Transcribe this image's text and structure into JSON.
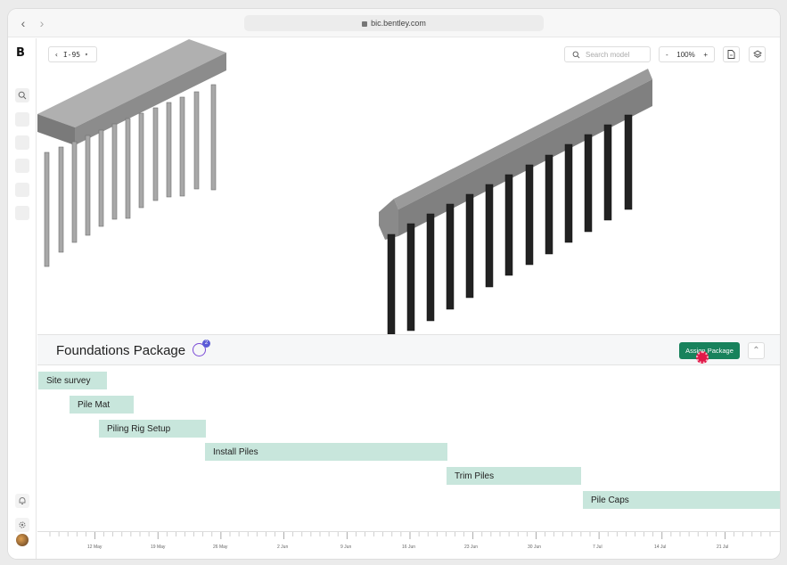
{
  "browser": {
    "url": "bic.bentley.com"
  },
  "rail": {
    "logo": "B"
  },
  "toolbar": {
    "model": "I-95",
    "search_placeholder": "Search model",
    "zoom_minus": "-",
    "zoom_level": "100%",
    "zoom_plus": "+"
  },
  "package": {
    "title": "Foundations Package",
    "badge_count": "2",
    "assign_label": "Assign Package"
  },
  "tasks": [
    {
      "name": "Site survey"
    },
    {
      "name": "Pile Mat"
    },
    {
      "name": "Piling Rig Setup"
    },
    {
      "name": "Install Piles"
    },
    {
      "name": "Trim Piles"
    },
    {
      "name": "Pile Caps"
    }
  ],
  "timeline": {
    "labels": [
      "12 May",
      "19 May",
      "26 May",
      "2 Jun",
      "9 Jun",
      "16 Jun",
      "23 Jun",
      "30 Jun",
      "7 Jul",
      "14 Jul",
      "21 Jul"
    ]
  },
  "colors": {
    "accent": "#18825c",
    "bar": "#c8e6dc",
    "cursor": "#e01848"
  }
}
